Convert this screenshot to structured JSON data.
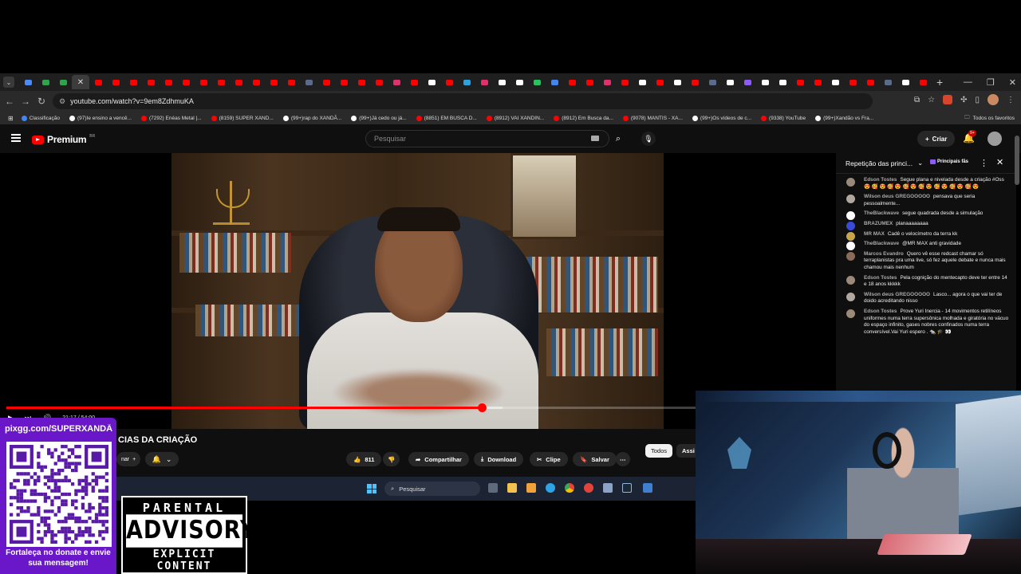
{
  "browser": {
    "url": "youtube.com/watch?v=9em8ZdhmuKA",
    "bookmarks": [
      {
        "label": "Classificação",
        "color": "#4285f4"
      },
      {
        "label": "(97)Ie ensino a vencê...",
        "color": "#ffffff"
      },
      {
        "label": "(7292) Enéas Metal |...",
        "color": "#ff0000"
      },
      {
        "label": "(8159) SUPER XAND...",
        "color": "#ff0000"
      },
      {
        "label": "(99+)rap do XANDÃ...",
        "color": "#ffffff"
      },
      {
        "label": "(99+)Já cedo ou já...",
        "color": "#ffffff"
      },
      {
        "label": "(8851) EM BUSCA D...",
        "color": "#ff0000"
      },
      {
        "label": "(8912) VAI XANDIN...",
        "color": "#ff0000"
      },
      {
        "label": "(8912) Em Busca da...",
        "color": "#ff0000"
      },
      {
        "label": "(9078) MANTIS - XA...",
        "color": "#ff0000"
      },
      {
        "label": "(99+)Os vídeos de c...",
        "color": "#ffffff"
      },
      {
        "label": "(9338) YouTube",
        "color": "#ff0000"
      },
      {
        "label": "(99+)Xandão vs Fra...",
        "color": "#ffffff"
      }
    ],
    "all_bookmarks": "Todos os favoritos"
  },
  "youtube": {
    "logo": "Premium",
    "logo_sup": "BR",
    "search_placeholder": "Pesquisar",
    "create_label": "Criar",
    "bell_badge": "9+",
    "time": "21:17 / 54:00",
    "video_title": "CIAS DA CRIAÇÃO",
    "subscribe_partial": "nar",
    "like_count": "811",
    "actions": {
      "share": "Compartilhar",
      "download": "Download",
      "clip": "Clipe",
      "save": "Salvar"
    },
    "chips": {
      "all": "Todos",
      "next": "Assi"
    },
    "progress": {
      "played": 0.69,
      "buffered": 0.72
    }
  },
  "chat": {
    "title": "Repetição das princi...",
    "fan_label": "Principais fãs",
    "messages": [
      {
        "author": "Edson Tostes",
        "text": "Segue plana e nivelada desde a criação #Oss 😍 🥰 😍 🥰 😍 🥰 😍 🥰 😍 🥰 😍 🥰 😍 🥰 😍",
        "avatar": "#9a8a7a"
      },
      {
        "author": "Wilson deus GREGOOOOO",
        "text": "pensava que seria pessoalmente...",
        "avatar": "#b0a8a0"
      },
      {
        "author": "TheBlackwave",
        "text": "segue quadrada desde a simulação",
        "avatar": "#ffffff"
      },
      {
        "author": "BRAZUMEX",
        "text": "planaaaaaaaa",
        "avatar": "#3a4bd8"
      },
      {
        "author": "MR MAX",
        "text": "Cadê o velocímetro da terra kk",
        "avatar": "#c9a54a"
      },
      {
        "author": "TheBlackwave",
        "text": "@MR MAX anti gravidade",
        "avatar": "#ffffff"
      },
      {
        "author": "Marcos Evandro",
        "text": "Quero vê esse redcast chamar só terraplanistas pra uma live, só fez aquele debate e nunca mais chamou mais nenhum",
        "avatar": "#8a6a5a"
      },
      {
        "author": "Edson Tostes",
        "text": "Pela cognição do mentecapto deve ter entre 14 e 18 anos kkkkk",
        "avatar": "#9a8a7a"
      },
      {
        "author": "Wilson deus GREGOOOOO",
        "text": "Lasco... agora o que vai ter de doido acreditando nisso",
        "avatar": "#b0a8a0"
      },
      {
        "author": "Edson Tostes",
        "text": "Prove Yuri Inercia - 14 movimentos retilíneos uniformes numa terra supersônica molhada e giratória no vácuo do espaço infinito, gases nobres confinados numa terra conversível.Vai Yuri espero . 🐀 🎓 👀",
        "avatar": "#9a8a7a"
      }
    ]
  },
  "taskbar": {
    "search": "Pesquisar"
  },
  "overlay": {
    "pix_url": "pixgg.com/SUPERXANDÃ",
    "pix_caption": "Fortaleça no donate e envie sua mensagem!",
    "advisory_top": "PARENTAL",
    "advisory_mid": "ADVISORY",
    "advisory_bot": "EXPLICIT CONTENT"
  },
  "colors": {
    "accent": "#ff0000",
    "pix_bg": "#6a17c9"
  }
}
